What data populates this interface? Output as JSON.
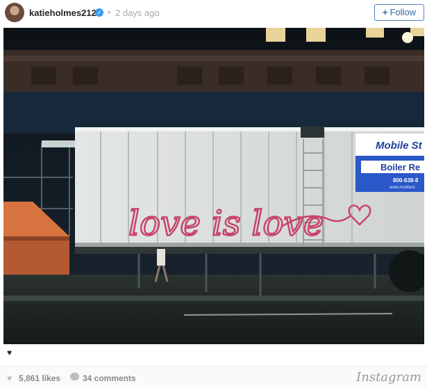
{
  "header": {
    "username": "katieholmes212",
    "verified_glyph": "✓",
    "separator": "•",
    "time_ago": "2 days ago",
    "follow_label": "Follow",
    "follow_icon": "+"
  },
  "photo": {
    "graffiti_text": "love is love",
    "trailer_sign_brand": "Mobile St",
    "trailer_sign_product": "Boiler Re",
    "trailer_sign_phone": "800-638-8",
    "trailer_sign_web": "www.mobilest",
    "colors": {
      "graffiti": "#c8446a",
      "sign_blue": "#2a58c9",
      "trailer": "#d9dcdb"
    }
  },
  "caption": {
    "heart": "♥"
  },
  "stats": {
    "heart_icon": "♥",
    "likes": "5,861 likes",
    "comments_icon": "speech-bubble-icon",
    "comments": "34 comments",
    "brand": "Instagram"
  }
}
